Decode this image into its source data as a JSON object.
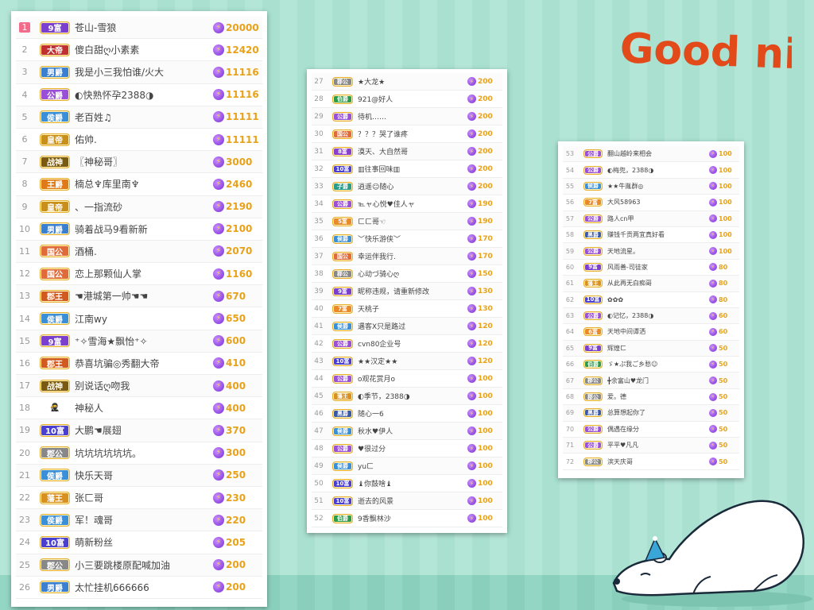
{
  "decoration": {
    "greeting": "Good night"
  },
  "icons": {
    "coin": "lightning-coin-icon",
    "bear": "polar-bear-illustration"
  },
  "colors": {
    "score": "#e8a21a",
    "rank_first": "#f26b8a",
    "badges": {
      "9富": "#7b3fd0",
      "大帝": "#c03030",
      "男爵": "#3a7fd0",
      "公爵": "#9a4fd8",
      "侯爵": "#3a8fd8",
      "皇帝": "#c8901a",
      "战神": "#7a5a10",
      "王爵": "#e07a18",
      "国公": "#e06a3a",
      "郡王": "#d05a20",
      "伯爵": "#2e9a4a",
      "子爵": "#2a9a8a",
      "5富": "#e88a2a",
      "7富": "#e88a2a",
      "10富": "#4a3fd0",
      "8富": "#8a3fd0",
      "6富": "#e88a2a",
      "藩王": "#d89020",
      "黑爵": "#3a5aa8"
    }
  },
  "panel1": {
    "rows": [
      {
        "rank": "1",
        "badge": "9富",
        "name": "苍山-雪狼",
        "score": "20000"
      },
      {
        "rank": "2",
        "badge": "大帝",
        "name": "傻白甜ღ小素素",
        "score": "12420"
      },
      {
        "rank": "3",
        "badge": "男爵",
        "name": "我是小三我怕谁/火大",
        "score": "11116"
      },
      {
        "rank": "4",
        "badge": "公爵",
        "name": "◐快熟怀孕2388◑",
        "score": "11116"
      },
      {
        "rank": "5",
        "badge": "侯爵",
        "name": "老百姓♫",
        "score": "11111"
      },
      {
        "rank": "6",
        "badge": "皇帝",
        "name": "佑帅.",
        "score": "11111"
      },
      {
        "rank": "7",
        "badge": "战神",
        "name": "〖神秘哥〗",
        "score": "3000"
      },
      {
        "rank": "8",
        "badge": "王爵",
        "name": "楠总♆库里南♆",
        "score": "2460"
      },
      {
        "rank": "9",
        "badge": "皇帝",
        "name": "、一指流砂",
        "score": "2190"
      },
      {
        "rank": "10",
        "badge": "男爵",
        "name": "骑着战马9看新新",
        "score": "2100"
      },
      {
        "rank": "11",
        "badge": "国公",
        "name": "酒桶.",
        "score": "2070"
      },
      {
        "rank": "12",
        "badge": "国公",
        "name": "恋上那颗仙人掌",
        "score": "1160"
      },
      {
        "rank": "13",
        "badge": "郡王",
        "name": "☚港城第一帅☚☚",
        "score": "670"
      },
      {
        "rank": "14",
        "badge": "侯爵",
        "name": "江南wy",
        "score": "650"
      },
      {
        "rank": "15",
        "badge": "9富",
        "name": "⁺✧雪海★飘怡⁺✧",
        "score": "600"
      },
      {
        "rank": "16",
        "badge": "郡王",
        "name": "恭喜坑骗◎秀翻大帝",
        "score": "410"
      },
      {
        "rank": "17",
        "badge": "战神",
        "name": "别说话ღ吻我",
        "score": "400"
      },
      {
        "rank": "18",
        "badge": "",
        "name": "神秘人",
        "score": "400"
      },
      {
        "rank": "19",
        "badge": "10富",
        "name": "大鹏☚展翅",
        "score": "370"
      },
      {
        "rank": "20",
        "badge": "郡公",
        "name": "坑坑坑坑坑坑。",
        "score": "300"
      },
      {
        "rank": "21",
        "badge": "侯爵",
        "name": "快乐天哥",
        "score": "250"
      },
      {
        "rank": "22",
        "badge": "藩王",
        "name": "张ㄈ哥",
        "score": "230"
      },
      {
        "rank": "23",
        "badge": "侯爵",
        "name": "军！魂哥",
        "score": "220"
      },
      {
        "rank": "24",
        "badge": "10富",
        "name": "萌新粉丝",
        "score": "205"
      },
      {
        "rank": "25",
        "badge": "郡公",
        "name": "小三要跳楼原配喊加油",
        "score": "200"
      },
      {
        "rank": "26",
        "badge": "男爵",
        "name": "太忙挂机666666",
        "score": "200"
      }
    ]
  },
  "panel2": {
    "rows": [
      {
        "rank": "27",
        "badge": "郡公",
        "name": "★大龙★",
        "score": "200"
      },
      {
        "rank": "28",
        "badge": "伯爵",
        "name": "921@好人",
        "score": "200"
      },
      {
        "rank": "29",
        "badge": "公爵",
        "name": "待机……",
        "score": "200"
      },
      {
        "rank": "30",
        "badge": "国公",
        "name": "？？？哭了谁疼",
        "score": "200"
      },
      {
        "rank": "31",
        "badge": "8富",
        "name": "漠天、大自然哥",
        "score": "200"
      },
      {
        "rank": "32",
        "badge": "10富",
        "name": "▥往事回味▥",
        "score": "200"
      },
      {
        "rank": "33",
        "badge": "子爵",
        "name": "逍遥☺随心",
        "score": "200"
      },
      {
        "rank": "34",
        "badge": "公爵",
        "name": "℡ャ心悦♥佳人ャ",
        "score": "190"
      },
      {
        "rank": "35",
        "badge": "5富",
        "name": "ㄈㄈ哥☜",
        "score": "190"
      },
      {
        "rank": "36",
        "badge": "侯爵",
        "name": "﹀快乐游侠﹀",
        "score": "170"
      },
      {
        "rank": "37",
        "badge": "国公",
        "name": "幸运伴我行.",
        "score": "170"
      },
      {
        "rank": "38",
        "badge": "郡公",
        "name": "心动づ骑心ღ",
        "score": "150"
      },
      {
        "rank": "39",
        "badge": "9富",
        "name": "昵称违规，请重新修改",
        "score": "130"
      },
      {
        "rank": "40",
        "badge": "7富",
        "name": "天桃子",
        "score": "130"
      },
      {
        "rank": "41",
        "badge": "侯爵",
        "name": "遇客Ⅹ只是路过",
        "score": "120"
      },
      {
        "rank": "42",
        "badge": "公爵",
        "name": "cvn80企业号",
        "score": "120"
      },
      {
        "rank": "43",
        "badge": "10富",
        "name": "★★汉定★★",
        "score": "120"
      },
      {
        "rank": "44",
        "badge": "公爵",
        "name": "o观花赏月o",
        "score": "100"
      },
      {
        "rank": "45",
        "badge": "藩王",
        "name": "◐季节，2388◑",
        "score": "100"
      },
      {
        "rank": "46",
        "badge": "黑爵",
        "name": "随心一6",
        "score": "100"
      },
      {
        "rank": "47",
        "badge": "侯爵",
        "name": "秋水♥伊人",
        "score": "100"
      },
      {
        "rank": "48",
        "badge": "公爵",
        "name": "♥很过分",
        "score": "100"
      },
      {
        "rank": "49",
        "badge": "侯爵",
        "name": "yuㄈ",
        "score": "100"
      },
      {
        "rank": "50",
        "badge": "10富",
        "name": "♝你鼓啥♝",
        "score": "100"
      },
      {
        "rank": "51",
        "badge": "10富",
        "name": "逝去的风景",
        "score": "100"
      },
      {
        "rank": "52",
        "badge": "伯爵",
        "name": "9香飘林沙",
        "score": "100"
      }
    ]
  },
  "panel3": {
    "rows": [
      {
        "rank": "53",
        "badge": "公爵",
        "name": "翻山越岭来相会",
        "score": "100"
      },
      {
        "rank": "54",
        "badge": "公爵",
        "name": "◐梅兜，2388◑",
        "score": "100"
      },
      {
        "rank": "55",
        "badge": "侯爵",
        "name": "★★牛胤群◎",
        "score": "100"
      },
      {
        "rank": "56",
        "badge": "7富",
        "name": "大风58963",
        "score": "100"
      },
      {
        "rank": "57",
        "badge": "公爵",
        "name": "路人cn甲",
        "score": "100"
      },
      {
        "rank": "58",
        "badge": "黑爵",
        "name": "赚钱千贡两宜真好看",
        "score": "100"
      },
      {
        "rank": "59",
        "badge": "公爵",
        "name": "天地流星。",
        "score": "100"
      },
      {
        "rank": "60",
        "badge": "9富",
        "name": "风雨善-司徒家",
        "score": "80"
      },
      {
        "rank": "61",
        "badge": "藩王",
        "name": "从此再无白痴哥",
        "score": "80"
      },
      {
        "rank": "62",
        "badge": "10富",
        "name": "✿✿✿",
        "score": "80"
      },
      {
        "rank": "63",
        "badge": "公爵",
        "name": "◐记忆，2388◑",
        "score": "60"
      },
      {
        "rank": "64",
        "badge": "6富",
        "name": "天地中间谭洒",
        "score": "60"
      },
      {
        "rank": "65",
        "badge": "9富",
        "name": "辉煌ㄈ",
        "score": "50"
      },
      {
        "rank": "66",
        "badge": "伯爵",
        "name": "ゞ★ぷ我ご乡愁☺",
        "score": "50"
      },
      {
        "rank": "67",
        "badge": "郡公",
        "name": "╋余富山♥龙门",
        "score": "50"
      },
      {
        "rank": "68",
        "badge": "郡公",
        "name": "爱。德",
        "score": "50"
      },
      {
        "rank": "69",
        "badge": "黑爵",
        "name": "总算想起你了",
        "score": "50"
      },
      {
        "rank": "70",
        "badge": "公爵",
        "name": "偶遇在缘分",
        "score": "50"
      },
      {
        "rank": "71",
        "badge": "公爵",
        "name": "平平♥凡凡",
        "score": "50"
      },
      {
        "rank": "72",
        "badge": "郡公",
        "name": "滨天庆哥",
        "score": "50"
      }
    ]
  }
}
